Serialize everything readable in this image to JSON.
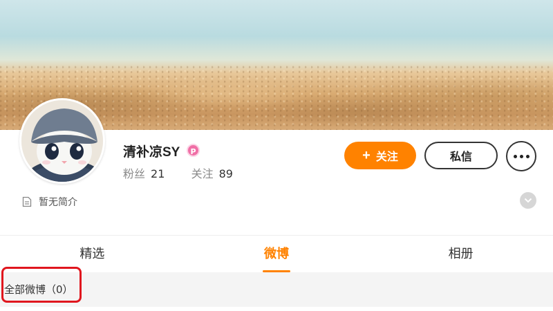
{
  "profile": {
    "username": "清补凉SY",
    "vip_badge": "P",
    "fans_label": "粉丝",
    "fans_count": "21",
    "following_label": "关注",
    "following_count": "89",
    "bio": "暂无简介"
  },
  "actions": {
    "follow_label": "关注",
    "message_label": "私信"
  },
  "tabs": [
    {
      "label": "精选",
      "active": false
    },
    {
      "label": "微博",
      "active": true
    },
    {
      "label": "相册",
      "active": false
    }
  ],
  "feed": {
    "all_posts_label": "全部微博（0）"
  },
  "colors": {
    "accent": "#ff8200",
    "highlight": "#e0161e",
    "vip": "#f06fa6"
  },
  "icons": {
    "bio": "document-icon",
    "expand": "chevron-down-icon",
    "more": "ellipsis-icon",
    "follow": "plus-icon",
    "vip": "vip-badge-icon"
  }
}
